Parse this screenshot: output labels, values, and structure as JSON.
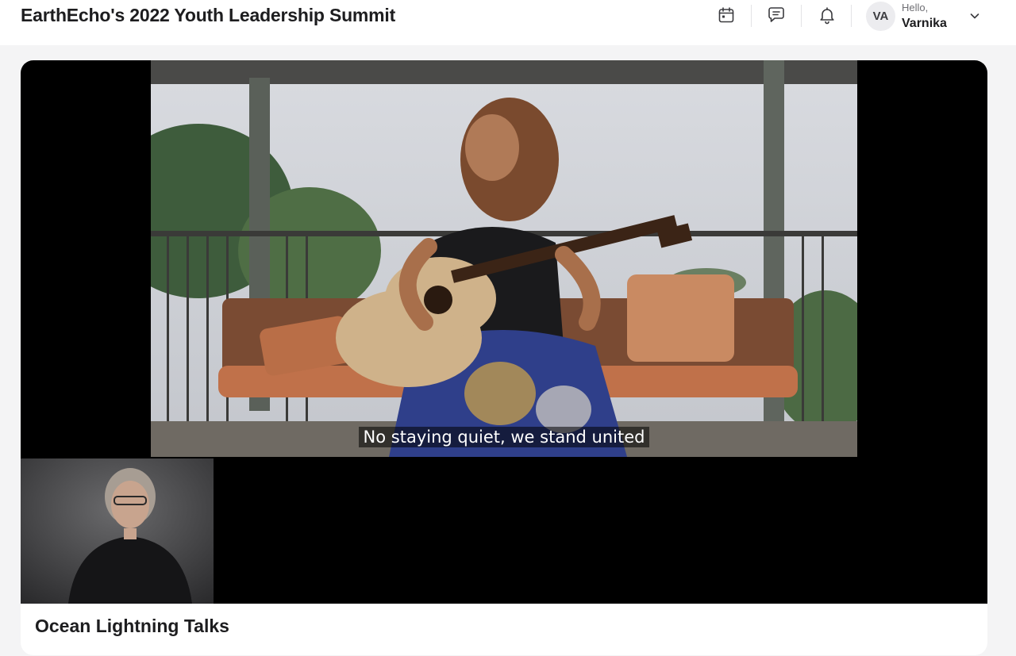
{
  "header": {
    "title": "EarthEcho's 2022 Youth Leadership Summit",
    "icons": [
      "calendar-icon",
      "chat-icon",
      "bell-icon"
    ],
    "user": {
      "initials": "VA",
      "greeting": "Hello,",
      "name": "Varnika"
    }
  },
  "player": {
    "caption": "No staying quiet, we stand united"
  },
  "session": {
    "title": "Ocean Lightning Talks"
  },
  "colors": {
    "page_bg": "#f4f4f5",
    "card_bg": "#ffffff",
    "video_bg": "#000000",
    "text": "#1d1d1f"
  }
}
